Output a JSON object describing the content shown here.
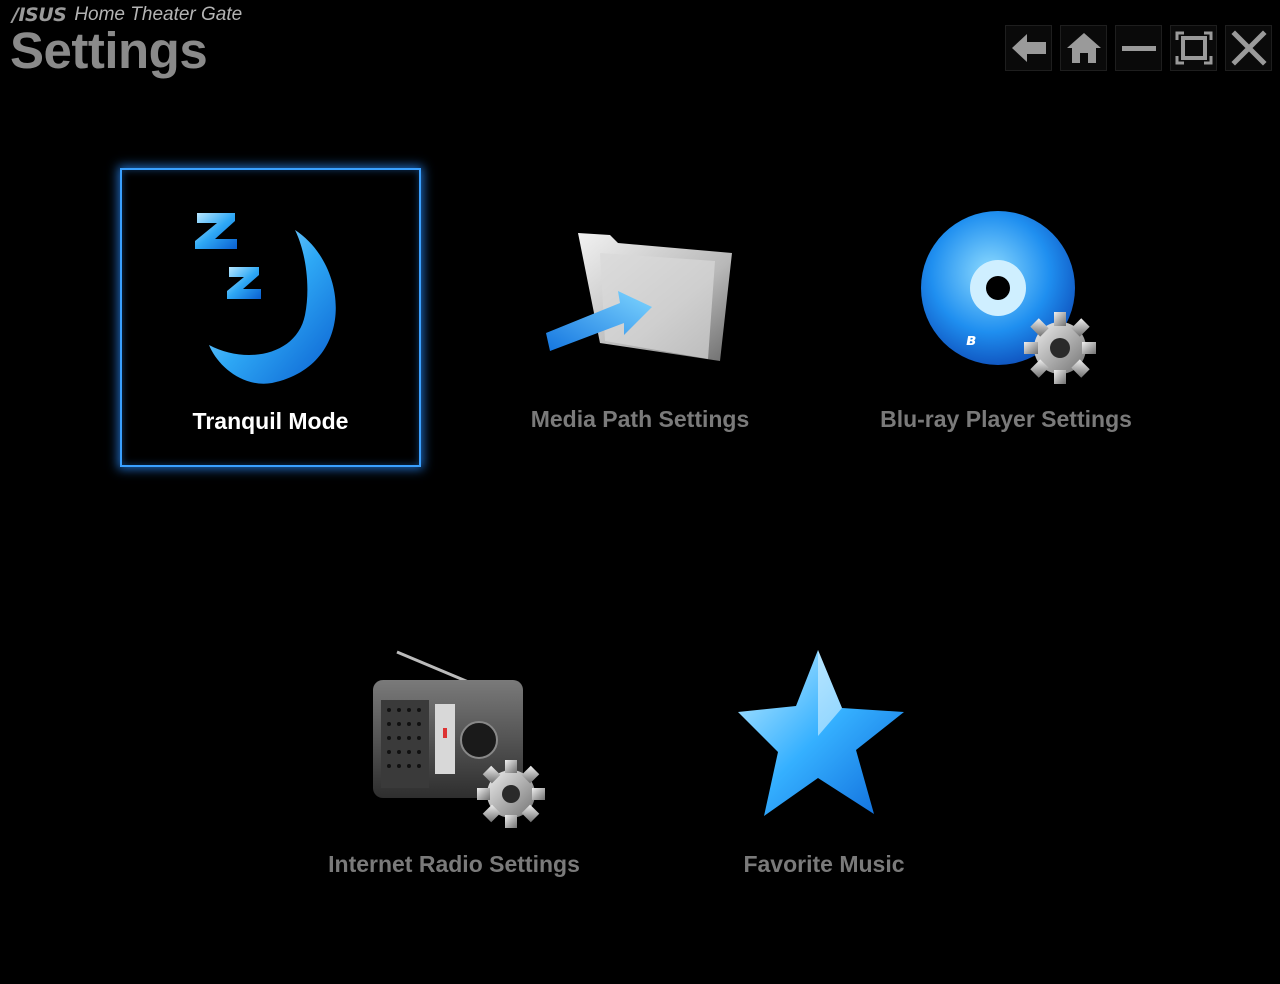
{
  "app": {
    "brand_logo": "/ISUS",
    "brand_name": "Home Theater Gate",
    "page_title": "Settings"
  },
  "window_controls": [
    "back-arrow-icon",
    "home-icon",
    "minimize-icon",
    "maximize-icon",
    "close-icon"
  ],
  "tiles": [
    {
      "label": "Tranquil Mode",
      "icon": "moon-zzz-icon",
      "selected": true
    },
    {
      "label": "Media Path Settings",
      "icon": "folder-arrow-icon",
      "selected": false
    },
    {
      "label": "Blu-ray Player Settings",
      "icon": "bluray-disc-gear-icon",
      "selected": false
    },
    {
      "label": "Internet Radio Settings",
      "icon": "radio-gear-icon",
      "selected": false
    },
    {
      "label": "Favorite Music",
      "icon": "star-icon",
      "selected": false
    }
  ],
  "colors": {
    "background": "#000000",
    "accent": "#3aa0ff",
    "label_inactive": "#7a7a7a",
    "label_active": "#ffffff"
  }
}
